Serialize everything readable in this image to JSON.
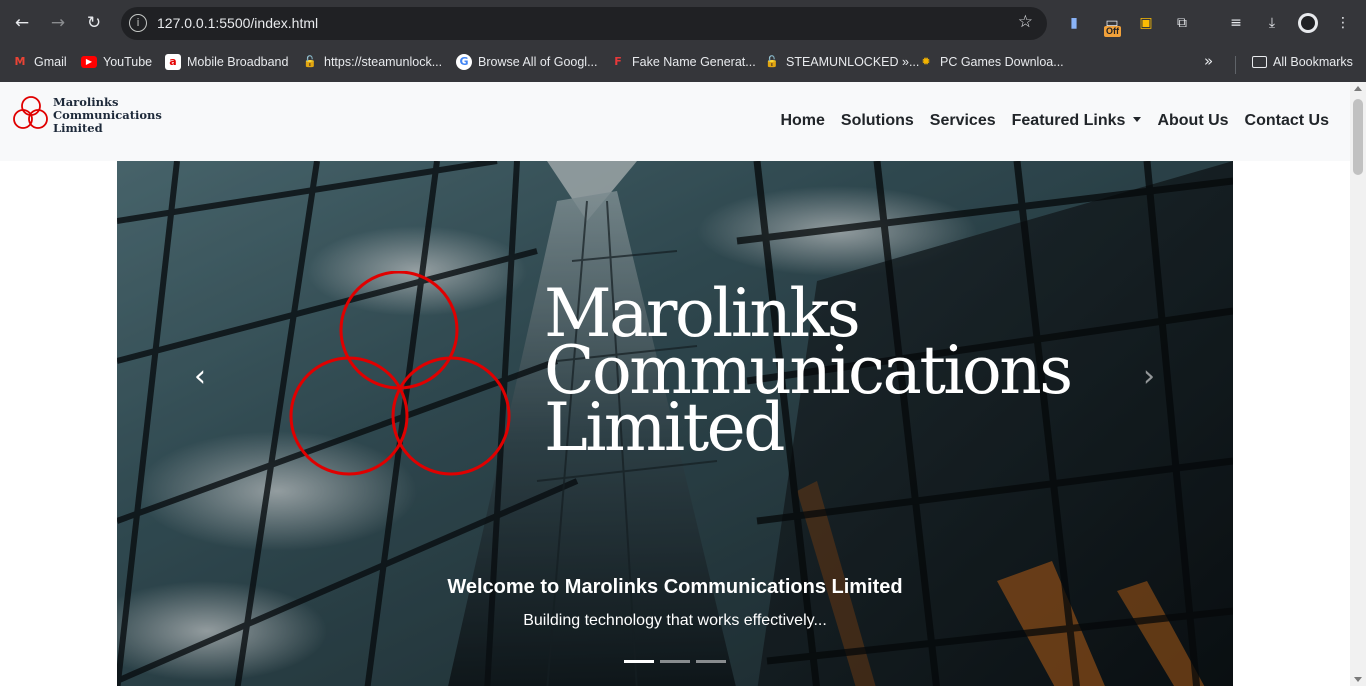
{
  "browser": {
    "url": "127.0.0.1:5500/index.html",
    "back_icon": "arrow-left-icon",
    "forward_icon": "arrow-right-icon",
    "reload_icon": "reload-icon",
    "extension_badge": "Off",
    "bookmarks": [
      {
        "label": "Gmail",
        "icon": "gmail-icon"
      },
      {
        "label": "YouTube",
        "icon": "youtube-icon"
      },
      {
        "label": "Mobile Broadband",
        "icon": "airtel-icon"
      },
      {
        "label": "https://steamunlock...",
        "icon": "steam-unlock-icon"
      },
      {
        "label": "Browse All of Googl...",
        "icon": "google-icon"
      },
      {
        "label": "Fake Name Generat...",
        "icon": "fake-name-icon"
      },
      {
        "label": "STEAMUNLOCKED »...",
        "icon": "steam-unlock-icon"
      },
      {
        "label": "PC Games Downloa...",
        "icon": "pc-games-icon"
      }
    ],
    "all_bookmarks_label": "All Bookmarks"
  },
  "site": {
    "brand": {
      "line1": "Marolinks",
      "line2": "Communications",
      "line3": "Limited"
    },
    "nav": {
      "home": "Home",
      "solutions": "Solutions",
      "services": "Services",
      "featured_links": "Featured Links",
      "about": "About Us",
      "contact": "Contact Us"
    },
    "hero": {
      "logo_line1": "Marolinks",
      "logo_line2": "Communications",
      "logo_line3": "Limited",
      "caption_title": "Welcome to Marolinks Communications Limited",
      "caption_text": "Building technology that works effectively...",
      "slides": 3,
      "active_slide": 1
    }
  },
  "colors": {
    "chrome_bg": "#35363a",
    "omnibox_bg": "#202124",
    "navbar_bg": "#f8f9fa",
    "brand_red": "#e00000",
    "brand_navy": "#1e2a3a"
  }
}
